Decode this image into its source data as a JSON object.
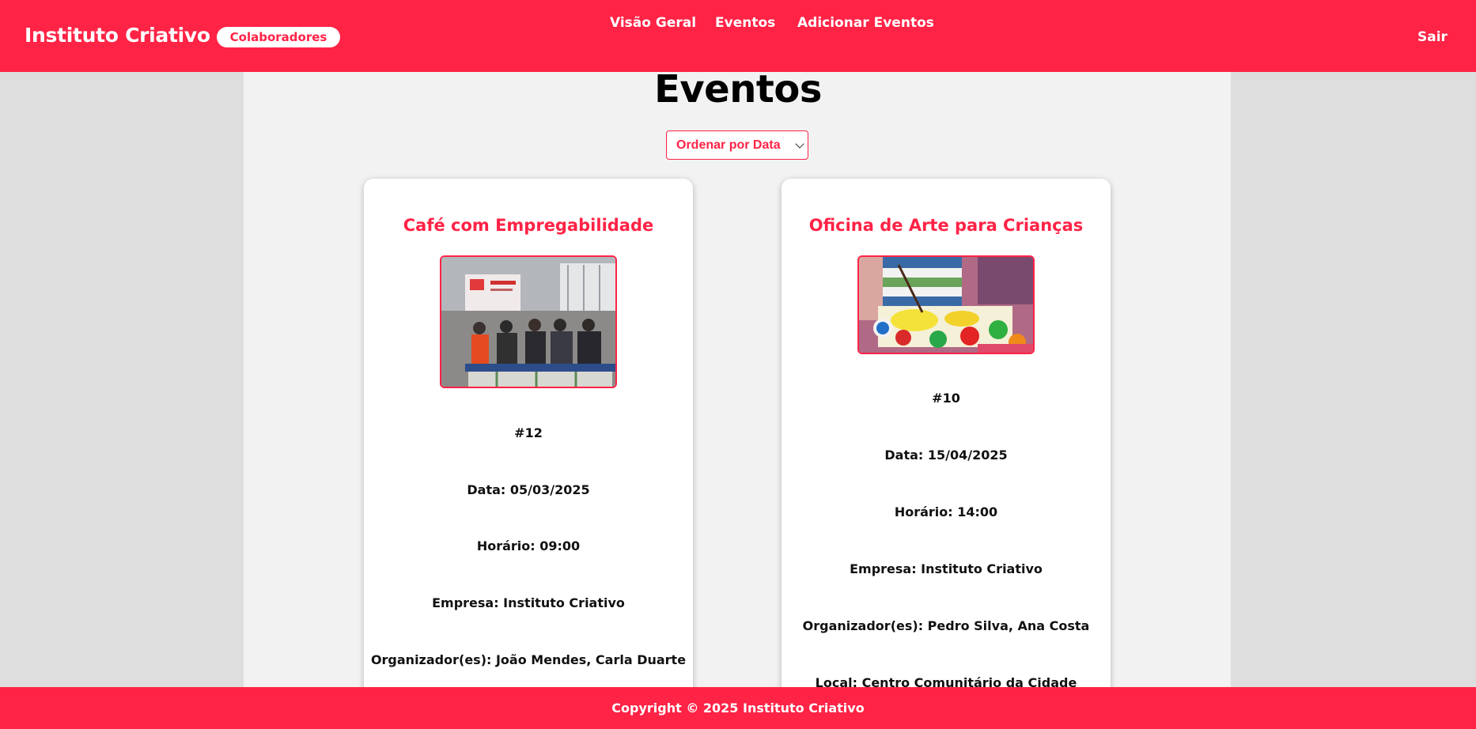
{
  "header": {
    "brand": "Instituto Criativo",
    "role": "Colaboradores",
    "nav": [
      "Visão Geral",
      "Eventos",
      "Adicionar Eventos"
    ],
    "logout": "Sair",
    "accent_color": "#ff2346"
  },
  "main": {
    "title": "Eventos",
    "sort": {
      "selected": "Ordenar por Data"
    }
  },
  "events": [
    {
      "title": "Café com Empregabilidade",
      "id_label": "#12",
      "date": "Data: 05/03/2025",
      "time": "Horário: 09:00",
      "company": "Empresa: Instituto Criativo",
      "organizers": "Organizador(es): João Mendes, Carla Duarte",
      "image_alt": "Palestra em sala com público sentado"
    },
    {
      "title": "Oficina de Arte para Crianças",
      "id_label": "#10",
      "date": "Data: 15/04/2025",
      "time": "Horário: 14:00",
      "company": "Empresa: Instituto Criativo",
      "organizers": "Organizador(es): Pedro Silva, Ana Costa",
      "location": "Local: Centro Comunitário da Cidade",
      "image_alt": "Criança pintando com tintas coloridas"
    }
  ],
  "footer": {
    "copyright": "Copyright © 2025 Instituto Criativo"
  }
}
